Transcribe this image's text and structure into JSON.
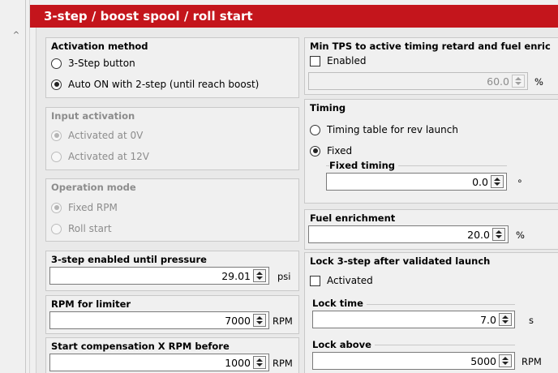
{
  "window": {
    "title": "3-step / boost spool / roll start"
  },
  "activation_method": {
    "title": "Activation method",
    "options": [
      "3-Step button",
      "Auto ON with 2-step (until reach boost)"
    ],
    "selected_index": 1
  },
  "input_activation": {
    "title": "Input activation",
    "options": [
      "Activated at 0V",
      "Activated at 12V"
    ],
    "selected_index": 0
  },
  "operation_mode": {
    "title": "Operation mode",
    "options": [
      "Fixed RPM",
      "Roll start"
    ],
    "selected_index": 0
  },
  "enabled_until_pressure": {
    "title": "3-step enabled until pressure",
    "value": "29.01",
    "unit": "psi"
  },
  "rpm_limiter": {
    "title": "RPM for limiter",
    "value": "7000",
    "unit": "RPM"
  },
  "start_compensation": {
    "title": "Start compensation X RPM before",
    "value": "1000",
    "unit": "RPM"
  },
  "min_tps": {
    "title": "Min TPS to active timing retard and fuel enric",
    "checkbox_label": "Enabled",
    "checked": false,
    "value": "60.0",
    "unit": "%"
  },
  "timing": {
    "title": "Timing",
    "options": [
      "Timing table for rev launch",
      "Fixed"
    ],
    "selected_index": 1,
    "fixed_timing": {
      "label": "Fixed timing",
      "value": "0.0",
      "unit": "°"
    }
  },
  "fuel_enrichment": {
    "title": "Fuel enrichment",
    "value": "20.0",
    "unit": "%"
  },
  "lock_3step": {
    "title": "Lock 3-step after validated launch",
    "checkbox_label": "Activated",
    "checked": false,
    "lock_time": {
      "label": "Lock time",
      "value": "7.0",
      "unit": "s"
    },
    "lock_above": {
      "label": "Lock above",
      "value": "5000",
      "unit": "RPM"
    }
  },
  "colors": {
    "title_bar": "#c4151c",
    "panel": "#f0f0f0",
    "border": "#c9c9c9"
  }
}
